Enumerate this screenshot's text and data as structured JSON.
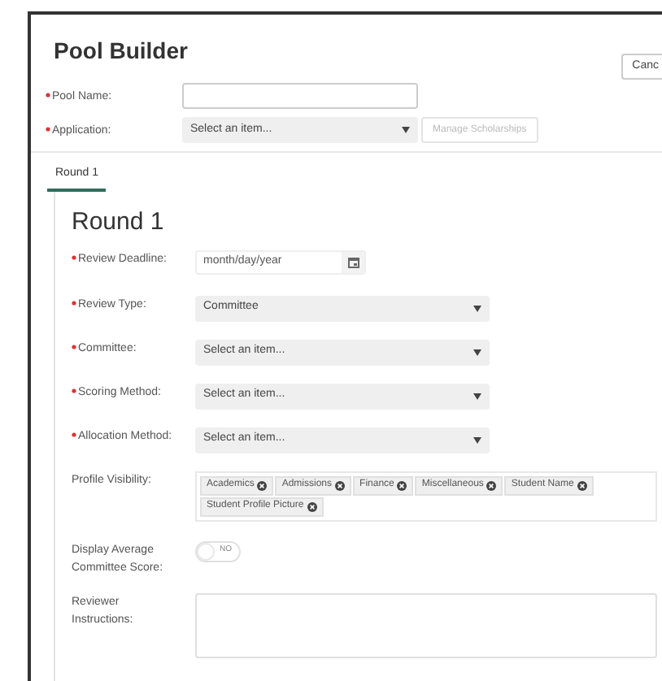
{
  "title": "Pool Builder",
  "cancel_button": "Canc",
  "top_fields": [
    {
      "kind": "input",
      "label": "Pool Name:",
      "required": true
    },
    {
      "kind": "select",
      "label": "Application:",
      "required": true,
      "value": "Select an item...",
      "button": "Manage Scholarships"
    }
  ],
  "tabs": [
    {
      "label": "Round 1",
      "selected": true
    }
  ],
  "round": {
    "heading": "Round 1",
    "fields": [
      {
        "kind": "date",
        "label": "Review Deadline:",
        "required": true,
        "placeholder": "month/day/year"
      },
      {
        "kind": "select",
        "label": "Review Type:",
        "required": true,
        "value": "Committee"
      },
      {
        "kind": "select",
        "label": "Committee:",
        "required": true,
        "value": "Select an item..."
      },
      {
        "kind": "select",
        "label": "Scoring Method:",
        "required": true,
        "value": "Select an item..."
      },
      {
        "kind": "select",
        "label": "Allocation Method:",
        "required": true,
        "value": "Select an item..."
      },
      {
        "kind": "tags",
        "label": "Profile Visibility:",
        "required": false,
        "tags": [
          "Academics",
          "Admissions",
          "Finance",
          "Miscellaneous",
          "Student Name",
          "Student Profile Picture"
        ]
      },
      {
        "kind": "toggle",
        "label": "Display Average Committee Score:",
        "required": false,
        "on": false,
        "state_text": "NO"
      },
      {
        "kind": "textarea",
        "label": "Reviewer Instructions:",
        "required": false
      }
    ]
  }
}
